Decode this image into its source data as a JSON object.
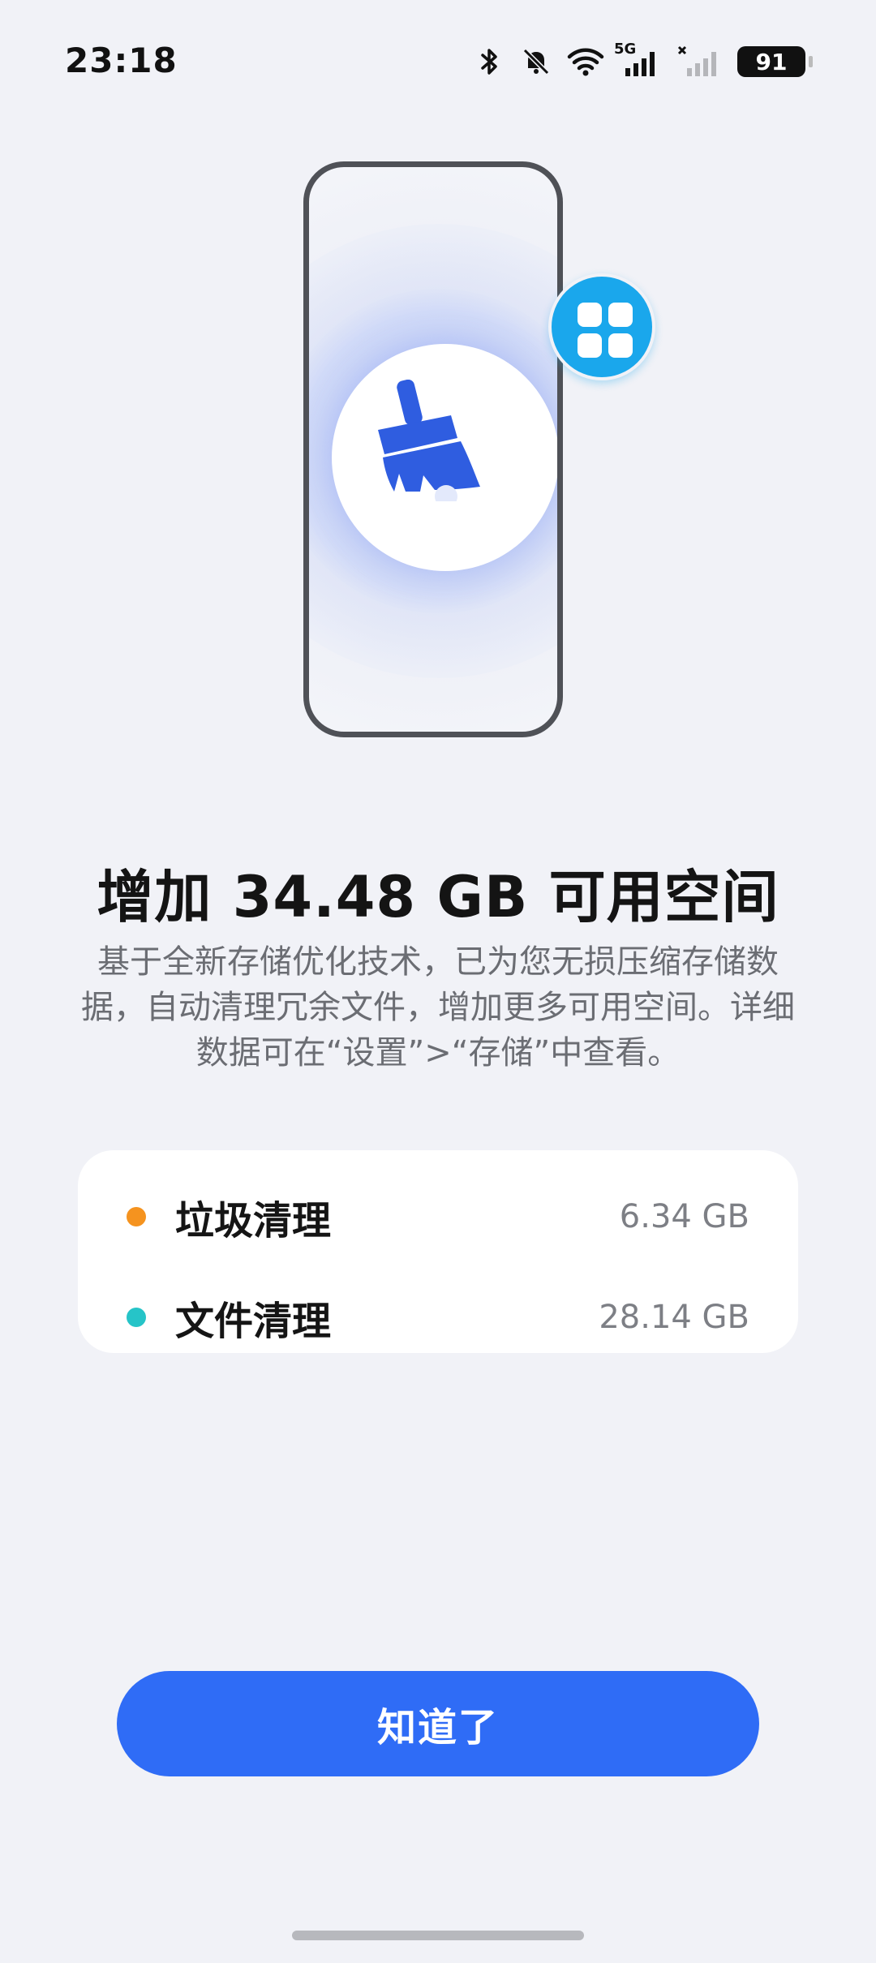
{
  "status_bar": {
    "time": "23:18",
    "signal_label": "5G",
    "battery_level": "91",
    "icons": [
      "bluetooth-icon",
      "mute-bell-icon",
      "wifi-icon",
      "signal-5g-icon",
      "signal-no-service-icon",
      "battery-icon"
    ]
  },
  "illustration": {
    "center_icon": "broom-clean-icon",
    "badge_icon": "app-grid-icon",
    "accent_color": "#2f5de0",
    "badge_color": "#1aa7ec"
  },
  "headline": "增加 34.48 GB 可用空间",
  "description": "基于全新存储优化技术，已为您无损压缩存储数据，自动清理冗余文件，增加更多可用空间。详细数据可在“设置”>“存储”中查看。",
  "summary": {
    "items": [
      {
        "label": "垃圾清理",
        "value": "6.34 GB",
        "dot_color": "#f5931f"
      },
      {
        "label": "文件清理",
        "value": "28.14 GB",
        "dot_color": "#26c4c8"
      }
    ]
  },
  "actions": {
    "ok_label": "知道了",
    "button_color": "#2f6cf6"
  }
}
